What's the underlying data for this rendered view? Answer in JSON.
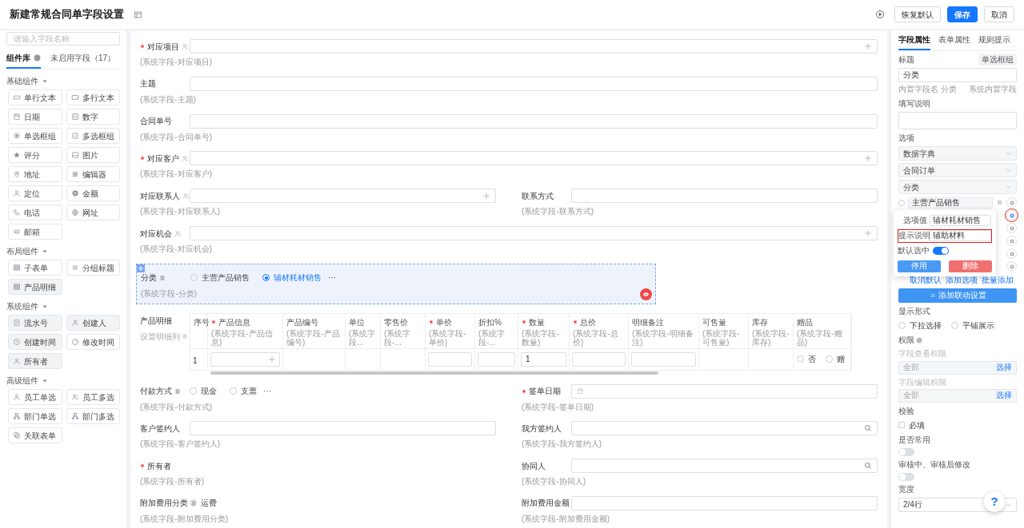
{
  "header": {
    "title": "新建常规合同单字段设置",
    "buttons": [
      {
        "label": "恢复默认",
        "kind": "default"
      },
      {
        "label": "保存",
        "kind": "primary"
      },
      {
        "label": "取消",
        "kind": "default"
      }
    ]
  },
  "sidebar": {
    "search_placeholder": "请输入字段名称",
    "tabs": [
      {
        "label": "组件库",
        "selected": true
      },
      {
        "label": "未启用字段（17）",
        "selected": false
      }
    ],
    "groups": [
      {
        "title": "基础组件",
        "items": [
          {
            "label": "单行文本",
            "used": false
          },
          {
            "label": "多行文本",
            "used": false
          },
          {
            "label": "日期",
            "used": false
          },
          {
            "label": "数字",
            "used": false
          },
          {
            "label": "单选框组",
            "used": false
          },
          {
            "label": "多选框组",
            "used": false
          },
          {
            "label": "评分",
            "used": false
          },
          {
            "label": "图片",
            "used": false
          },
          {
            "label": "地址",
            "used": false
          },
          {
            "label": "编辑器",
            "used": false
          },
          {
            "label": "定位",
            "used": false
          },
          {
            "label": "金额",
            "used": false
          },
          {
            "label": "电话",
            "used": false
          },
          {
            "label": "网址",
            "used": false
          },
          {
            "label": "邮箱",
            "used": false
          }
        ]
      },
      {
        "title": "布局组件",
        "items": [
          {
            "label": "子表单",
            "used": false
          },
          {
            "label": "分组标题",
            "used": false
          },
          {
            "label": "产品明细",
            "used": true
          }
        ]
      },
      {
        "title": "系统组件",
        "items": [
          {
            "label": "流水号",
            "used": true
          },
          {
            "label": "创建人",
            "used": true
          },
          {
            "label": "创建时间",
            "used": true
          },
          {
            "label": "修改时间",
            "used": false
          },
          {
            "label": "所有者",
            "used": true
          }
        ]
      },
      {
        "title": "高级组件",
        "items": [
          {
            "label": "员工单选",
            "used": false
          },
          {
            "label": "员工多选",
            "used": false
          },
          {
            "label": "部门单选",
            "used": false
          },
          {
            "label": "部门多选",
            "used": false
          },
          {
            "label": "关联表单",
            "used": false
          }
        ]
      }
    ]
  },
  "form": {
    "rows": [
      {
        "fields": [
          {
            "label": "对应项目",
            "sub": "(系统字段-对应项目)",
            "required": true,
            "linked": true,
            "kind": "plus",
            "selected": false
          }
        ]
      },
      {
        "fields": [
          {
            "label": "主题",
            "sub": "(系统字段-主题)",
            "required": false,
            "linked": false,
            "kind": "text",
            "selected": false
          }
        ]
      },
      {
        "fields": [
          {
            "label": "合同单号",
            "sub": "(系统字段-合同单号)",
            "required": false,
            "linked": false,
            "kind": "text",
            "selected": false
          }
        ]
      },
      {
        "fields": [
          {
            "label": "对应客户",
            "sub": "(系统字段-对应客户)",
            "required": true,
            "linked": true,
            "kind": "plus",
            "selected": false
          }
        ]
      },
      {
        "fields": [
          {
            "label": "对应联系人",
            "sub": "(系统字段-对应联系人)",
            "required": false,
            "linked": true,
            "kind": "plus",
            "selected": false
          },
          {
            "label": "联系方式",
            "sub": "(系统字段-联系方式)",
            "required": false,
            "linked": false,
            "kind": "text",
            "selected": false
          }
        ]
      },
      {
        "fields": [
          {
            "label": "对应机会",
            "sub": "(系统字段-对应机会)",
            "required": false,
            "linked": true,
            "kind": "plus",
            "selected": false
          }
        ]
      },
      {
        "fields": [
          {
            "label": "分类",
            "sub": "(系统字段-分类)",
            "required": false,
            "linked": false,
            "kind": "radio",
            "selected": true,
            "options": [
              {
                "label": "主营产品销售",
                "selected": false
              },
              {
                "label": "辅材耗材销售",
                "selected": true
              }
            ],
            "more": "···"
          }
        ]
      },
      {
        "fields": [
          {
            "label": "产品明细",
            "sub": "设置明细列",
            "kind": "table",
            "columns": [
              {
                "title": "序号",
                "required": false
              },
              {
                "title": "产品信息",
                "sub": "(系统字段-产品信息)",
                "required": true
              },
              {
                "title": "产品编号",
                "sub": "(系统字段-产品编号)",
                "required": false
              },
              {
                "title": "单位",
                "sub": "(系统字段...",
                "required": false
              },
              {
                "title": "零售价",
                "sub": "(系统字段-...",
                "required": false
              },
              {
                "title": "单价",
                "sub": "(系统字段-单价)",
                "required": true
              },
              {
                "title": "折扣%",
                "sub": "(系统字段-...",
                "required": false
              },
              {
                "title": "数量",
                "sub": "(系统字段-数量)",
                "required": true
              },
              {
                "title": "总价",
                "sub": "(系统字段-总价)",
                "required": true
              },
              {
                "title": "明细备注",
                "sub": "(系统字段-明细备注)",
                "required": false
              },
              {
                "title": "可售量",
                "sub": "(系统字段-可售量)",
                "required": false
              },
              {
                "title": "库存",
                "sub": "(系统字段-库存)",
                "required": false
              },
              {
                "title": "赠品",
                "sub": "(系统字段-赠品)",
                "required": false
              }
            ],
            "cells": [
              {
                "kind": "text",
                "value": "1"
              },
              {
                "kind": "plus"
              },
              {
                "kind": "empty"
              },
              {
                "kind": "empty"
              },
              {
                "kind": "empty"
              },
              {
                "kind": "input"
              },
              {
                "kind": "input"
              },
              {
                "kind": "input",
                "value": "1"
              },
              {
                "kind": "input"
              },
              {
                "kind": "input"
              },
              {
                "kind": "empty"
              },
              {
                "kind": "empty"
              },
              {
                "kind": "radio",
                "options": [
                  {
                    "label": "否",
                    "selected": false
                  },
                  {
                    "label": "赠",
                    "selected": false
                  }
                ]
              }
            ]
          }
        ]
      },
      {
        "fields": [
          {
            "label": "付款方式",
            "sub": "(系统字段-付款方式)",
            "required": false,
            "linked": false,
            "kind": "radio",
            "selected": false,
            "options": [
              {
                "label": "现金",
                "selected": false
              },
              {
                "label": "支票",
                "selected": false
              }
            ],
            "more": "···"
          },
          {
            "label": "签单日期",
            "sub": "(系统字段-签单日期)",
            "required": true,
            "linked": false,
            "kind": "date",
            "selected": false
          }
        ]
      },
      {
        "fields": [
          {
            "label": "客户签约人",
            "sub": "(系统字段-客户签约人)",
            "required": false,
            "linked": false,
            "kind": "text",
            "selected": false
          },
          {
            "label": "我方签约人",
            "sub": "(系统字段-我方签约人)",
            "required": false,
            "linked": false,
            "kind": "search",
            "selected": false
          }
        ]
      },
      {
        "fields": [
          {
            "label": "所有者",
            "sub": "(系统字段-所有者)",
            "required": true,
            "linked": false,
            "kind": "none",
            "selected": false
          },
          {
            "label": "协同人",
            "sub": "(系统字段-协同人)",
            "required": false,
            "linked": false,
            "kind": "search",
            "selected": false
          }
        ]
      },
      {
        "fields": [
          {
            "label": "附加费用分类",
            "sub": "(系统字段-附加费用分类)",
            "required": false,
            "linked": false,
            "kind": "radio",
            "selected": false,
            "options": [
              {
                "label": "运费",
                "selected": false
              }
            ]
          },
          {
            "label": "附加费用金额",
            "sub": "(系统字段-附加费用金额)",
            "required": false,
            "linked": false,
            "kind": "text",
            "selected": false
          }
        ]
      }
    ]
  },
  "panel": {
    "tabs": [
      {
        "label": "字段属性",
        "selected": true
      },
      {
        "label": "表单属性",
        "selected": false
      },
      {
        "label": "规则提示",
        "selected": false
      }
    ],
    "title_label": "标题",
    "type_badge": "单选框组",
    "title_value": "分类",
    "internal_name": "内置字段名 分类",
    "internal_note": "系统内置字段",
    "desc_label": "填写说明",
    "options_label": "选项",
    "selects": [
      "数据字典",
      "合同订单",
      "分类"
    ],
    "options": [
      {
        "label": "主营产品销售",
        "selected": false,
        "highlighted": false
      },
      {
        "highlighted": true
      },
      {
        "highlighted": false
      },
      {
        "highlighted": false
      },
      {
        "highlighted": false
      },
      {
        "highlighted": false
      }
    ],
    "popover": {
      "fields": [
        {
          "label": "选项值",
          "value": "辅材耗材销售",
          "highlighted": false
        },
        {
          "label": "提示说明",
          "value": "辅助材料",
          "highlighted": true
        }
      ],
      "default_label": "默认选中",
      "default_on": true,
      "buttons": [
        {
          "label": "停用",
          "kind": "primary"
        },
        {
          "label": "删除",
          "kind": "danger"
        }
      ]
    },
    "links": [
      "取消默认",
      "添加选项",
      "批量添加"
    ],
    "linkage_button": "添加联动设置",
    "display_label": "显示形式",
    "display_options": [
      {
        "label": "下拉选择",
        "selected": false
      },
      {
        "label": "平铺展示",
        "selected": false
      }
    ],
    "permission_label": "权限",
    "permissions": [
      {
        "label": "字段查看权限",
        "placeholder": "全部",
        "action": "选择"
      },
      {
        "label": "字段编辑权限",
        "placeholder": "全部",
        "action": "选择"
      }
    ],
    "validation_label": "校验",
    "required_check": {
      "label": "必填",
      "checked": false
    },
    "toggles": [
      {
        "label": "是否常用",
        "on": false
      },
      {
        "label": "审核中、审核后修改",
        "on": false
      }
    ],
    "width_label": "宽度",
    "width_value": "2/4行",
    "help": "?"
  }
}
